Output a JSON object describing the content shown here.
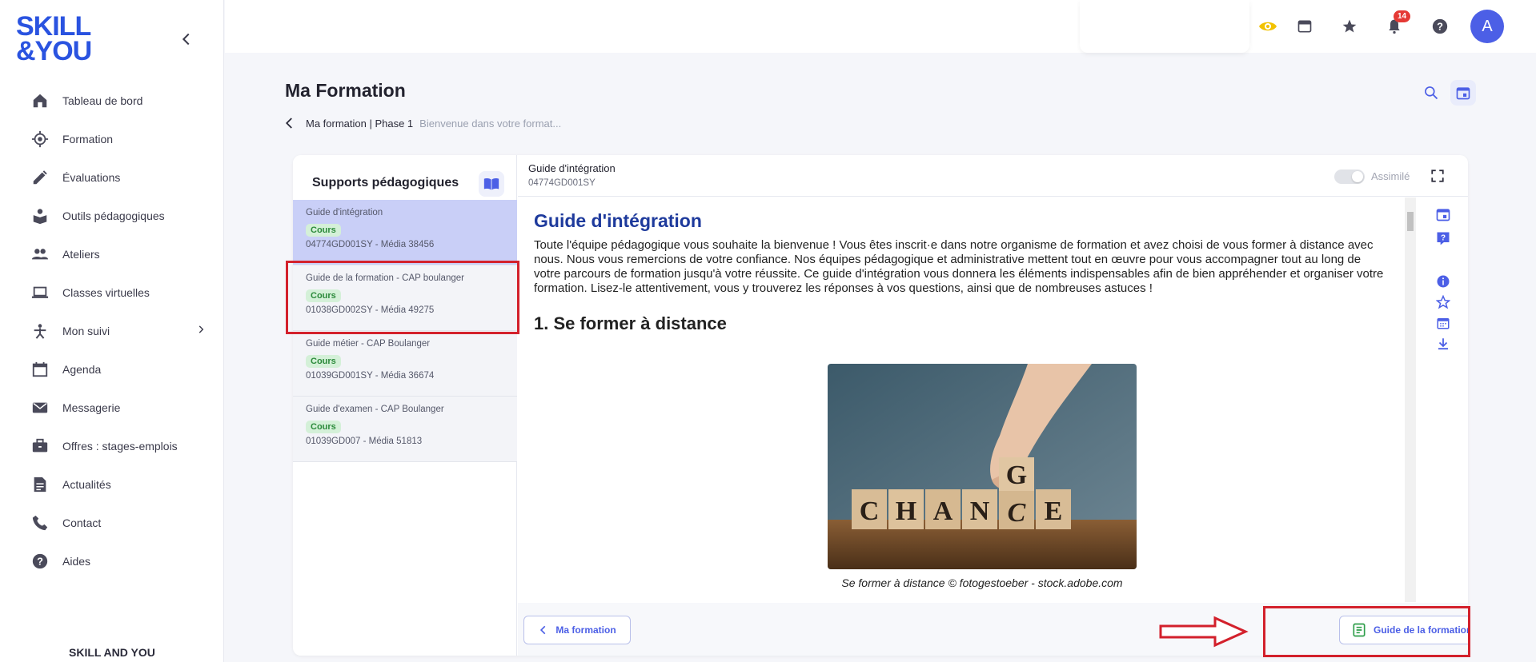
{
  "brand": {
    "logo_line1": "SKILL",
    "logo_line2": "&YOU",
    "footer": "SKILL AND YOU"
  },
  "sidebar": {
    "items": [
      {
        "label": "Tableau de bord",
        "icon": "home-icon"
      },
      {
        "label": "Formation",
        "icon": "target-icon"
      },
      {
        "label": "Évaluations",
        "icon": "pencil-icon"
      },
      {
        "label": "Outils pédagogiques",
        "icon": "tools-icon"
      },
      {
        "label": "Ateliers",
        "icon": "people-icon"
      },
      {
        "label": "Classes virtuelles",
        "icon": "laptop-icon"
      },
      {
        "label": "Mon suivi",
        "icon": "progress-icon"
      },
      {
        "label": "Agenda",
        "icon": "calendar-icon"
      },
      {
        "label": "Messagerie",
        "icon": "mail-icon"
      },
      {
        "label": "Offres : stages-emplois",
        "icon": "briefcase-icon"
      },
      {
        "label": "Actualités",
        "icon": "news-icon"
      },
      {
        "label": "Contact",
        "icon": "phone-icon"
      },
      {
        "label": "Aides",
        "icon": "help-icon"
      }
    ]
  },
  "topbar": {
    "notifications": "14",
    "avatar": "A"
  },
  "header": {
    "title": "Ma Formation",
    "crumb_main": "Ma formation | Phase 1",
    "crumb_sub": "Bienvenue dans votre format..."
  },
  "supports": {
    "title": "Supports pédagogiques",
    "items": [
      {
        "title": "Guide d'intégration",
        "tag": "Cours",
        "meta": "04774GD001SY - Média 38456",
        "active": true
      },
      {
        "title": "Guide de la formation - CAP boulanger",
        "tag": "Cours",
        "meta": "01038GD002SY - Média 49275",
        "active": false
      },
      {
        "title": "Guide métier - CAP Boulanger",
        "tag": "Cours",
        "meta": "01039GD001SY - Média 36674",
        "active": false
      },
      {
        "title": "Guide d'examen - CAP Boulanger",
        "tag": "Cours",
        "meta": "01039GD007 - Média 51813",
        "active": false
      }
    ]
  },
  "content": {
    "title": "Guide d'intégration",
    "code": "04774GD001SY",
    "toggle_label": "Assimilé",
    "doc_title": "Guide d'intégration",
    "doc_intro": "Toute l'équipe pédagogique vous souhaite la bienvenue ! Vous êtes inscrit·e dans notre organisme de formation et avez choisi de vous former à distance avec nous. Nous vous remercions de votre confiance. Nos équipes pédagogique et administrative mettent tout en œuvre pour vous accompagner tout au long de votre parcours de formation jusqu'à votre réussite. Ce guide d'intégration vous donnera les éléments indispensables afin de bien appréhender et organiser votre formation. Lisez-le attentivement, vous y trouverez les réponses à vos questions, ainsi que de nombreuses astuces !",
    "section_heading": "1. Se former à distance",
    "photo_caption": "Se former à distance © fotogestoeber - stock.adobe.com",
    "photo_letters": [
      "C",
      "H",
      "A",
      "N",
      "G",
      "C",
      "E"
    ]
  },
  "footer": {
    "back_label": "Ma formation",
    "next_label": "Guide de la formation - ..."
  },
  "colors": {
    "accent": "#4c5fe6",
    "logo": "#2a53e0",
    "highlight": "#d3212c",
    "tag_bg": "#d4f0d8"
  }
}
